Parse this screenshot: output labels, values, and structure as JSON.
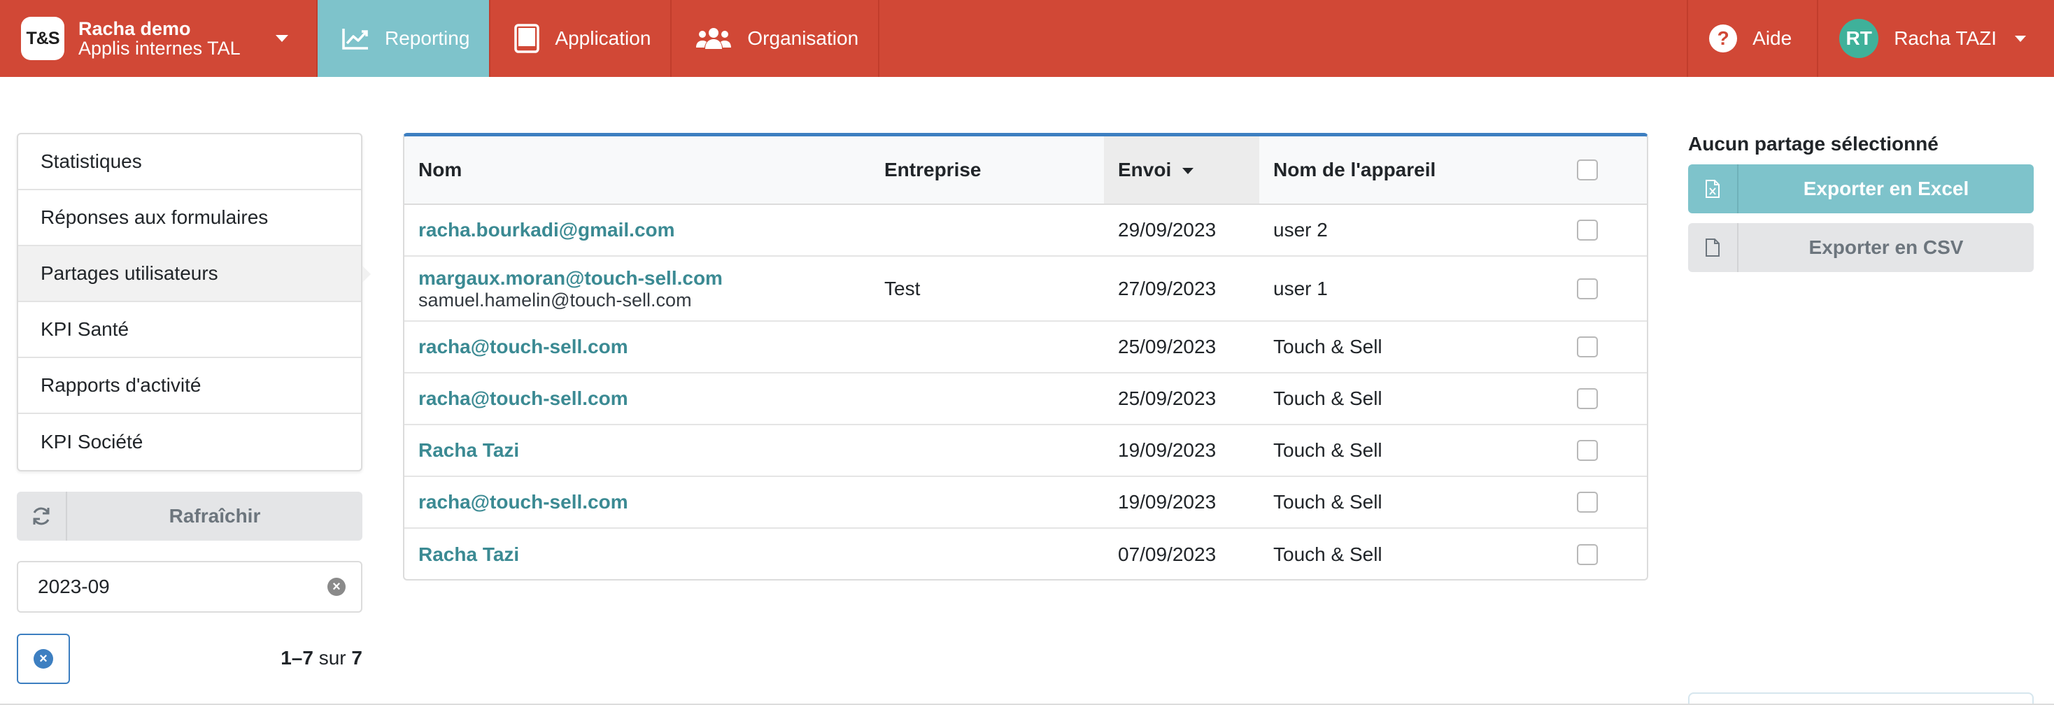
{
  "header": {
    "logo_text": "T&S",
    "brand_name": "Racha demo",
    "brand_sub": "Applis internes TAL",
    "nav": [
      {
        "label": "Reporting",
        "icon": "chart-line-icon",
        "active": true
      },
      {
        "label": "Application",
        "icon": "tablet-icon",
        "active": false
      },
      {
        "label": "Organisation",
        "icon": "users-icon",
        "active": false
      }
    ],
    "help_label": "Aide",
    "user_initials": "RT",
    "user_name": "Racha TAZI"
  },
  "sidebar": {
    "items": [
      {
        "label": "Statistiques"
      },
      {
        "label": "Réponses aux formulaires"
      },
      {
        "label": "Partages utilisateurs",
        "active": true
      },
      {
        "label": "KPI Santé"
      },
      {
        "label": "Rapports d'activité"
      },
      {
        "label": "KPI Société"
      }
    ],
    "refresh_label": "Rafraîchir",
    "date_filter_value": "2023-09",
    "pager": {
      "range": "1–7",
      "sep": "sur",
      "total": "7"
    }
  },
  "table": {
    "columns": [
      "Nom",
      "Entreprise",
      "Envoi",
      "Nom de l'appareil"
    ],
    "sorted_column": "Envoi",
    "rows": [
      {
        "nom": "racha.bourkadi@gmail.com",
        "nom_sub": "",
        "entreprise": "",
        "envoi": "29/09/2023",
        "appareil": "user 2"
      },
      {
        "nom": "margaux.moran@touch-sell.com",
        "nom_sub": "samuel.hamelin@touch-sell.com",
        "entreprise": "Test",
        "envoi": "27/09/2023",
        "appareil": "user 1"
      },
      {
        "nom": "racha@touch-sell.com",
        "nom_sub": "",
        "entreprise": "",
        "envoi": "25/09/2023",
        "appareil": "Touch & Sell"
      },
      {
        "nom": "racha@touch-sell.com",
        "nom_sub": "",
        "entreprise": "",
        "envoi": "25/09/2023",
        "appareil": "Touch & Sell"
      },
      {
        "nom": "Racha Tazi",
        "nom_sub": "",
        "entreprise": "",
        "envoi": "19/09/2023",
        "appareil": "Touch & Sell"
      },
      {
        "nom": "racha@touch-sell.com",
        "nom_sub": "",
        "entreprise": "",
        "envoi": "19/09/2023",
        "appareil": "Touch & Sell"
      },
      {
        "nom": "Racha Tazi",
        "nom_sub": "",
        "entreprise": "",
        "envoi": "07/09/2023",
        "appareil": "Touch & Sell"
      }
    ]
  },
  "right_panel": {
    "title": "Aucun partage sélectionné",
    "export_excel_label": "Exporter en Excel",
    "export_csv_label": "Exporter en CSV"
  },
  "colors": {
    "header_bg": "#d14836",
    "active_nav": "#7ec3cb",
    "link": "#3b8a93",
    "table_accent": "#3d7fc1"
  }
}
